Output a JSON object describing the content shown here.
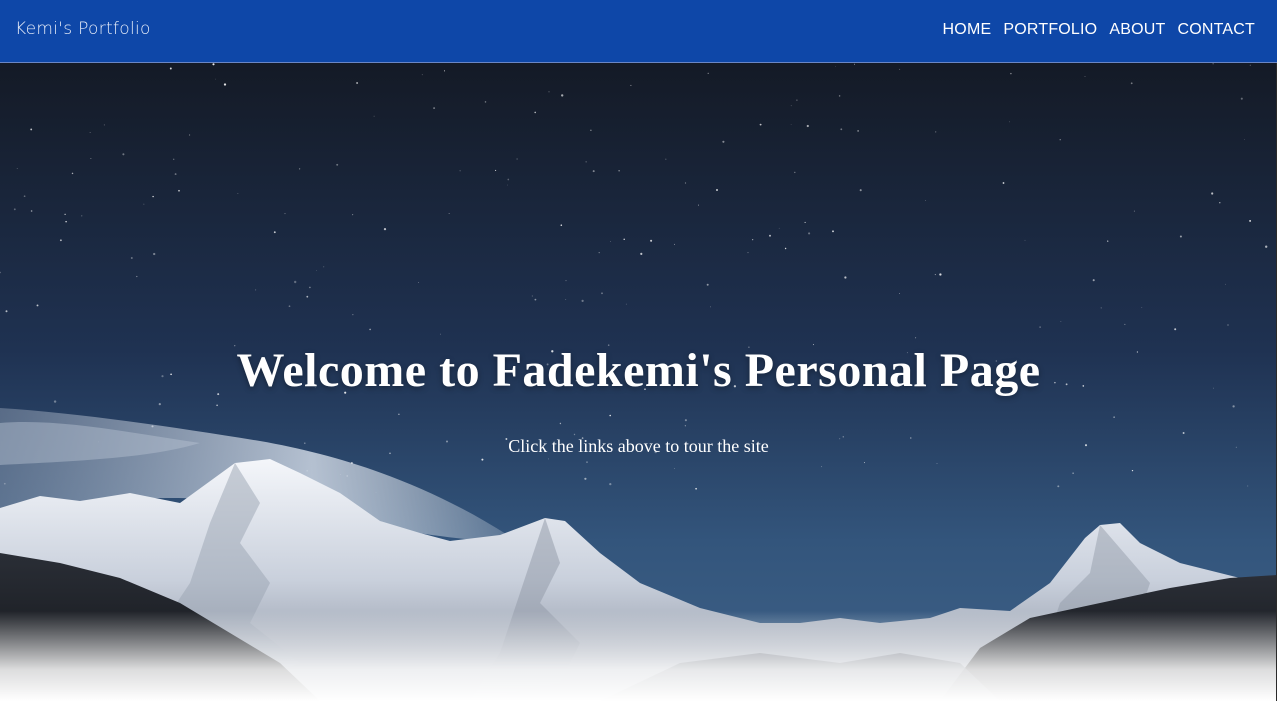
{
  "navbar": {
    "brand": "Kemi's Portfolio",
    "links": [
      {
        "label": "HOME"
      },
      {
        "label": "PORTFOLIO"
      },
      {
        "label": "ABOUT"
      },
      {
        "label": "CONTACT"
      }
    ],
    "background_color": "#0e47a8"
  },
  "hero": {
    "title": "Welcome to Fadekemi's Personal Page",
    "subtitle": "Click the links above to tour the site",
    "image": "night-sky-snowy-mountains"
  }
}
